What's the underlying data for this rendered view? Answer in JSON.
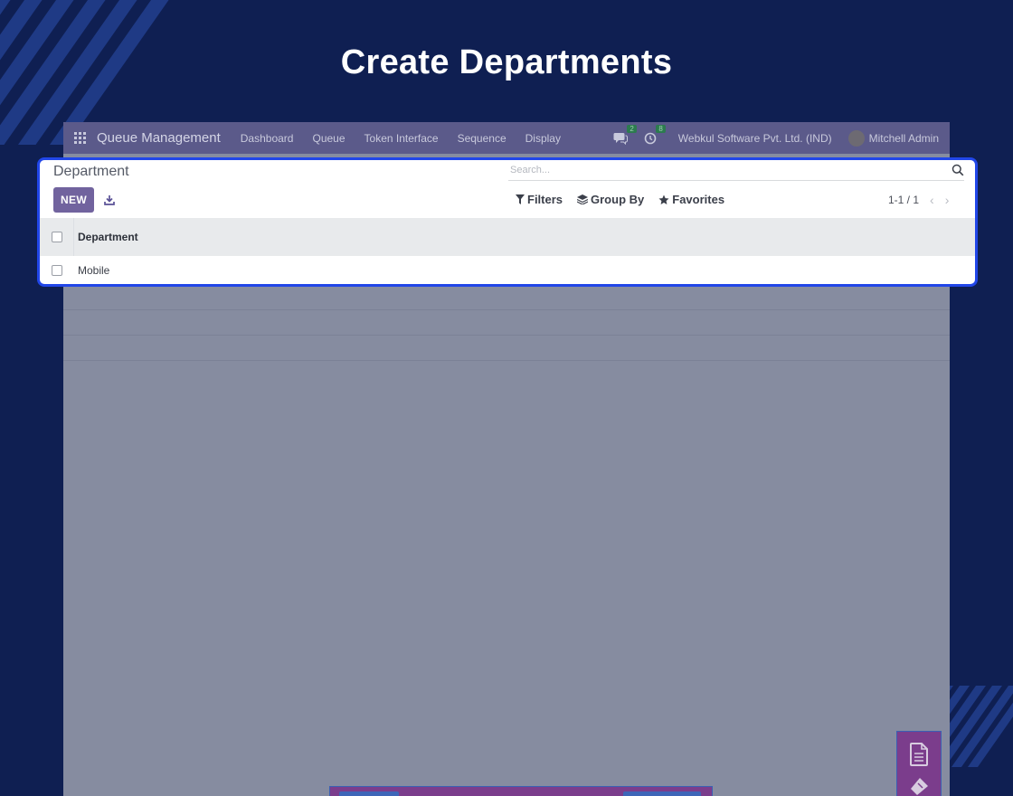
{
  "headline": "Create Departments",
  "colors": {
    "background": "#0f1f52",
    "accent_stripes": "#1f3a85",
    "highlight_border": "#2146e8",
    "primary_button": "#71639e",
    "navbar": "#5b5a8a"
  },
  "navbar": {
    "app_name": "Queue Management",
    "menu": [
      "Dashboard",
      "Queue",
      "Token Interface",
      "Sequence",
      "Display"
    ],
    "messages_count": "2",
    "activities_count": "8",
    "company": "Webkul Software Pvt. Ltd. (IND)",
    "user": "Mitchell Admin"
  },
  "control_panel": {
    "title": "Department",
    "new_label": "NEW",
    "search_placeholder": "Search...",
    "filters_label": "Filters",
    "group_by_label": "Group By",
    "favorites_label": "Favorites",
    "pager": "1-1 / 1"
  },
  "list": {
    "column_header": "Department",
    "rows": [
      "Mobile"
    ]
  },
  "icons": {
    "apps": "grid-icon",
    "messages": "chat-icon",
    "activities": "clock-icon",
    "download": "download-icon",
    "search": "search-icon",
    "filter": "funnel-icon",
    "group_by": "layers-icon",
    "favorites": "star-icon",
    "prev": "chevron-left-icon",
    "next": "chevron-right-icon"
  }
}
